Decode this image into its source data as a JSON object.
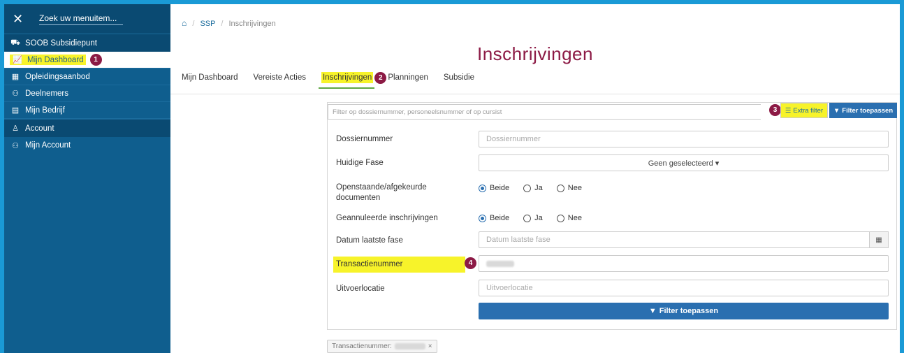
{
  "sidebar": {
    "search_placeholder": "Zoek uw menuitem...",
    "sections": [
      {
        "label": "SOOB Subsidiepunt"
      },
      {
        "label": "Account"
      }
    ],
    "items": [
      {
        "label": "Mijn Dashboard",
        "badge": "1"
      },
      {
        "label": "Opleidingsaanbod"
      },
      {
        "label": "Deelnemers"
      },
      {
        "label": "Mijn Bedrijf"
      },
      {
        "label": "Mijn Account"
      }
    ]
  },
  "breadcrumb": {
    "level1": "SSP",
    "level2": "Inschrijvingen"
  },
  "page_title": "Inschrijvingen",
  "tabs": [
    {
      "label": "Mijn Dashboard"
    },
    {
      "label": "Vereiste Acties"
    },
    {
      "label": "Inschrijvingen",
      "badge": "2"
    },
    {
      "label": "Planningen"
    },
    {
      "label": "Subsidie"
    }
  ],
  "filter": {
    "search_placeholder": "Filter op dossiernummer, personeelsnummer of op cursist",
    "badge3": "3",
    "extra_filter_label": "Extra filter",
    "apply_small_label": "Filter toepassen",
    "fields": {
      "dossier_label": "Dossiernummer",
      "dossier_placeholder": "Dossiernummer",
      "fase_label": "Huidige Fase",
      "fase_value": "Geen geselecteerd ▾",
      "docs_label": "Openstaande/afgekeurde documenten",
      "cancel_label": "Geannuleerde inschrijvingen",
      "radio_both": "Beide",
      "radio_yes": "Ja",
      "radio_no": "Nee",
      "date_label": "Datum laatste fase",
      "date_placeholder": "Datum laatste fase",
      "transactie_label": "Transactienummer",
      "badge4": "4",
      "locatie_label": "Uitvoerlocatie",
      "locatie_placeholder": "Uitvoerlocatie"
    },
    "apply_label": "Filter toepassen"
  },
  "chip": {
    "label": "Transactienummer:",
    "close": "×"
  }
}
